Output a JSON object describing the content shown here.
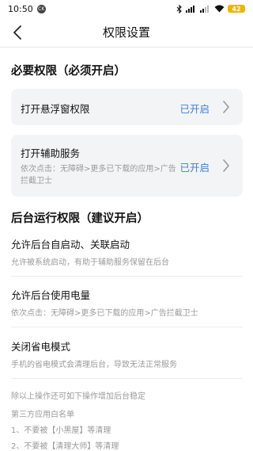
{
  "status_bar": {
    "time": "10:50",
    "badge": "CK",
    "battery": "42"
  },
  "header": {
    "title": "权限设置"
  },
  "required": {
    "title": "必要权限（必须开启）",
    "float_window": {
      "label": "打开悬浮窗权限",
      "status": "已开启"
    },
    "accessibility": {
      "label": "打开辅助服务",
      "desc": "依次点击：无障碍>更多已下载的应用>广告拦截卫士",
      "status": "已开启"
    }
  },
  "background": {
    "title": "后台运行权限（建议开启）",
    "items": [
      {
        "title": "允许后台自启动、关联启动",
        "desc": "允许被系统启动，有助于辅助服务保留在后台"
      },
      {
        "title": "允许后台使用电量",
        "desc": "依次点击：无障碍>更多已下载的应用>广告拦截卫士"
      },
      {
        "title": "关闭省电模式",
        "desc": "手机的省电模式会清理后台，导致无法正常服务"
      }
    ]
  },
  "notes": [
    "除以上操作还可如下操作增加后台稳定",
    "第三方应用白名单",
    "1、不要被【小黑屋】等清理",
    "2、不要被【清理大师】等清理"
  ]
}
